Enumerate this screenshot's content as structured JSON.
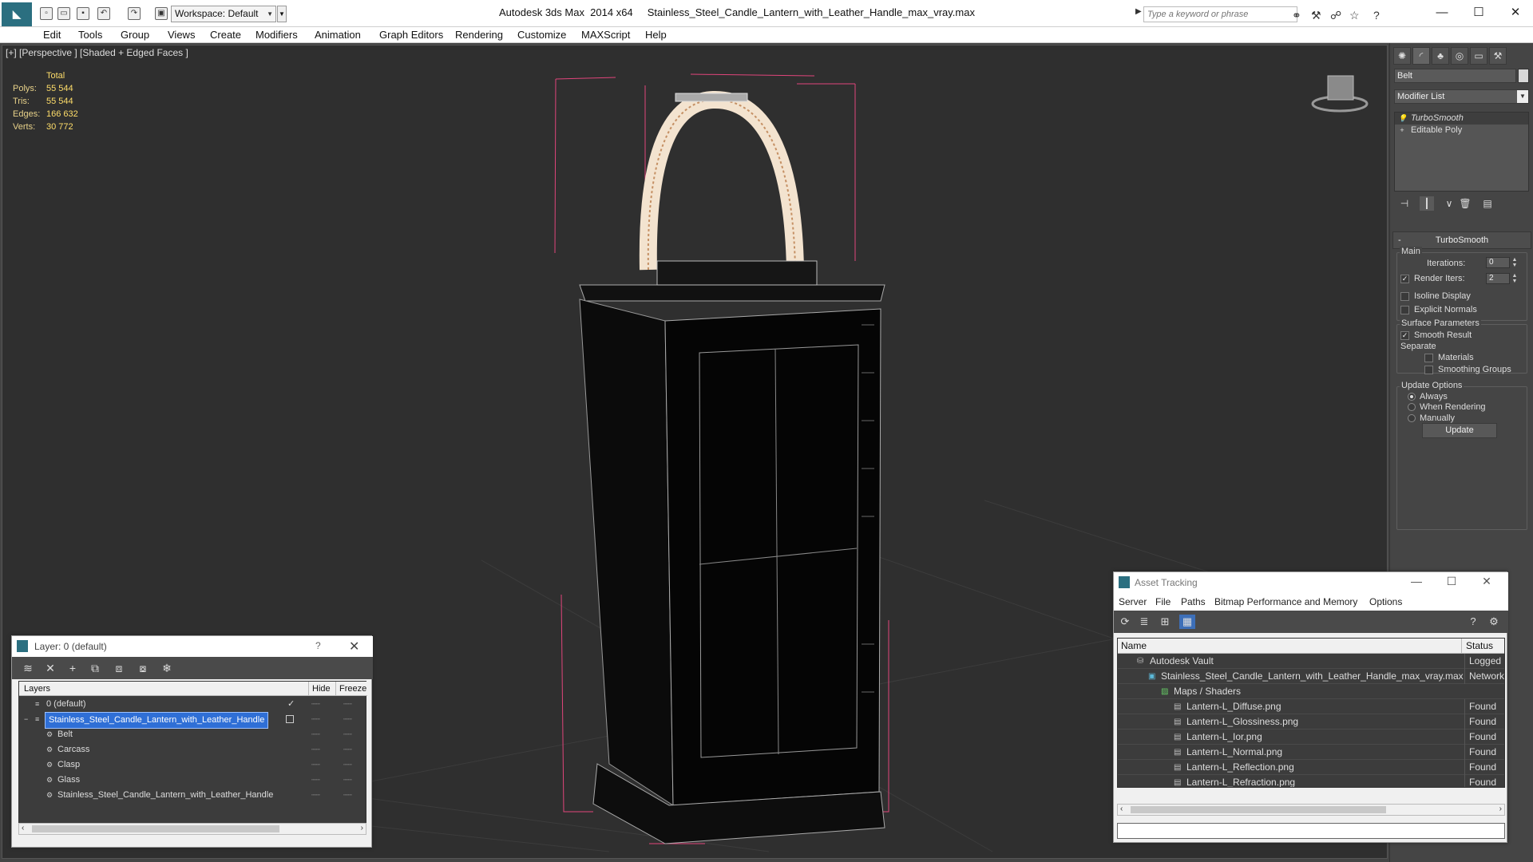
{
  "app": {
    "title": "Autodesk 3ds Max  2014 x64     Stainless_Steel_Candle_Lantern_with_Leather_Handle_max_vray.max",
    "workspace": "Workspace: Default",
    "search_placeholder": "Type a keyword or phrase"
  },
  "menu": [
    "Edit",
    "Tools",
    "Group",
    "Views",
    "Create",
    "Modifiers",
    "Animation",
    "Graph Editors",
    "Rendering",
    "Customize",
    "MAXScript",
    "Help"
  ],
  "viewport": {
    "label": "[+] [Perspective ] [Shaded + Edged Faces ]",
    "stats": {
      "header": "Total",
      "polys_label": "Polys:",
      "polys": "55 544",
      "tris_label": "Tris:",
      "tris": "55 544",
      "edges_label": "Edges:",
      "edges": "166 632",
      "verts_label": "Verts:",
      "verts": "30 772"
    }
  },
  "command_panel": {
    "object_name": "Belt",
    "modifier_list": "Modifier List",
    "stack": [
      "TurboSmooth",
      "Editable Poly"
    ],
    "turbosmooth": {
      "title": "TurboSmooth",
      "main_label": "Main",
      "iterations_label": "Iterations:",
      "iterations": "0",
      "render_iters_label": "Render Iters:",
      "render_iters": "2",
      "isoline_label": "Isoline Display",
      "explicit_normals_label": "Explicit Normals",
      "surface_params_label": "Surface Parameters",
      "smooth_result_label": "Smooth Result",
      "separate_label": "Separate",
      "materials_label": "Materials",
      "smoothing_groups_label": "Smoothing Groups",
      "update_options_label": "Update Options",
      "always_label": "Always",
      "when_rendering_label": "When Rendering",
      "manually_label": "Manually",
      "update_button": "Update"
    }
  },
  "layer_window": {
    "title": "Layer: 0 (default)",
    "help": "?",
    "columns": {
      "layers": "Layers",
      "hide": "Hide",
      "freeze": "Freeze"
    },
    "rows": [
      {
        "name": "0 (default)",
        "indent": 0,
        "check": "✓"
      },
      {
        "name": "Stainless_Steel_Candle_Lantern_with_Leather_Handle",
        "indent": 0,
        "selected": true
      },
      {
        "name": "Belt",
        "indent": 1
      },
      {
        "name": "Carcass",
        "indent": 1
      },
      {
        "name": "Clasp",
        "indent": 1
      },
      {
        "name": "Glass",
        "indent": 1
      },
      {
        "name": "Stainless_Steel_Candle_Lantern_with_Leather_Handle",
        "indent": 1
      }
    ]
  },
  "asset_window": {
    "title": "Asset Tracking",
    "menu": [
      "Server",
      "File",
      "Paths",
      "Bitmap Performance and Memory",
      "Options"
    ],
    "columns": {
      "name": "Name",
      "status": "Status"
    },
    "rows": [
      {
        "name": "Autodesk Vault",
        "status": "Logged O",
        "indent": 1
      },
      {
        "name": "Stainless_Steel_Candle_Lantern_with_Leather_Handle_max_vray.max",
        "status": "Network F",
        "indent": 2
      },
      {
        "name": "Maps / Shaders",
        "status": "",
        "indent": 3
      },
      {
        "name": "Lantern-L_Diffuse.png",
        "status": "Found",
        "indent": 4
      },
      {
        "name": "Lantern-L_Glossiness.png",
        "status": "Found",
        "indent": 4
      },
      {
        "name": "Lantern-L_Ior.png",
        "status": "Found",
        "indent": 4
      },
      {
        "name": "Lantern-L_Normal.png",
        "status": "Found",
        "indent": 4
      },
      {
        "name": "Lantern-L_Reflection.png",
        "status": "Found",
        "indent": 4
      },
      {
        "name": "Lantern-L_Refraction.png",
        "status": "Found",
        "indent": 4
      }
    ]
  },
  "colors": {
    "selection": "#2f6fd6",
    "stats_text": "#ffde6a",
    "bounding_box": "#e0457b"
  }
}
